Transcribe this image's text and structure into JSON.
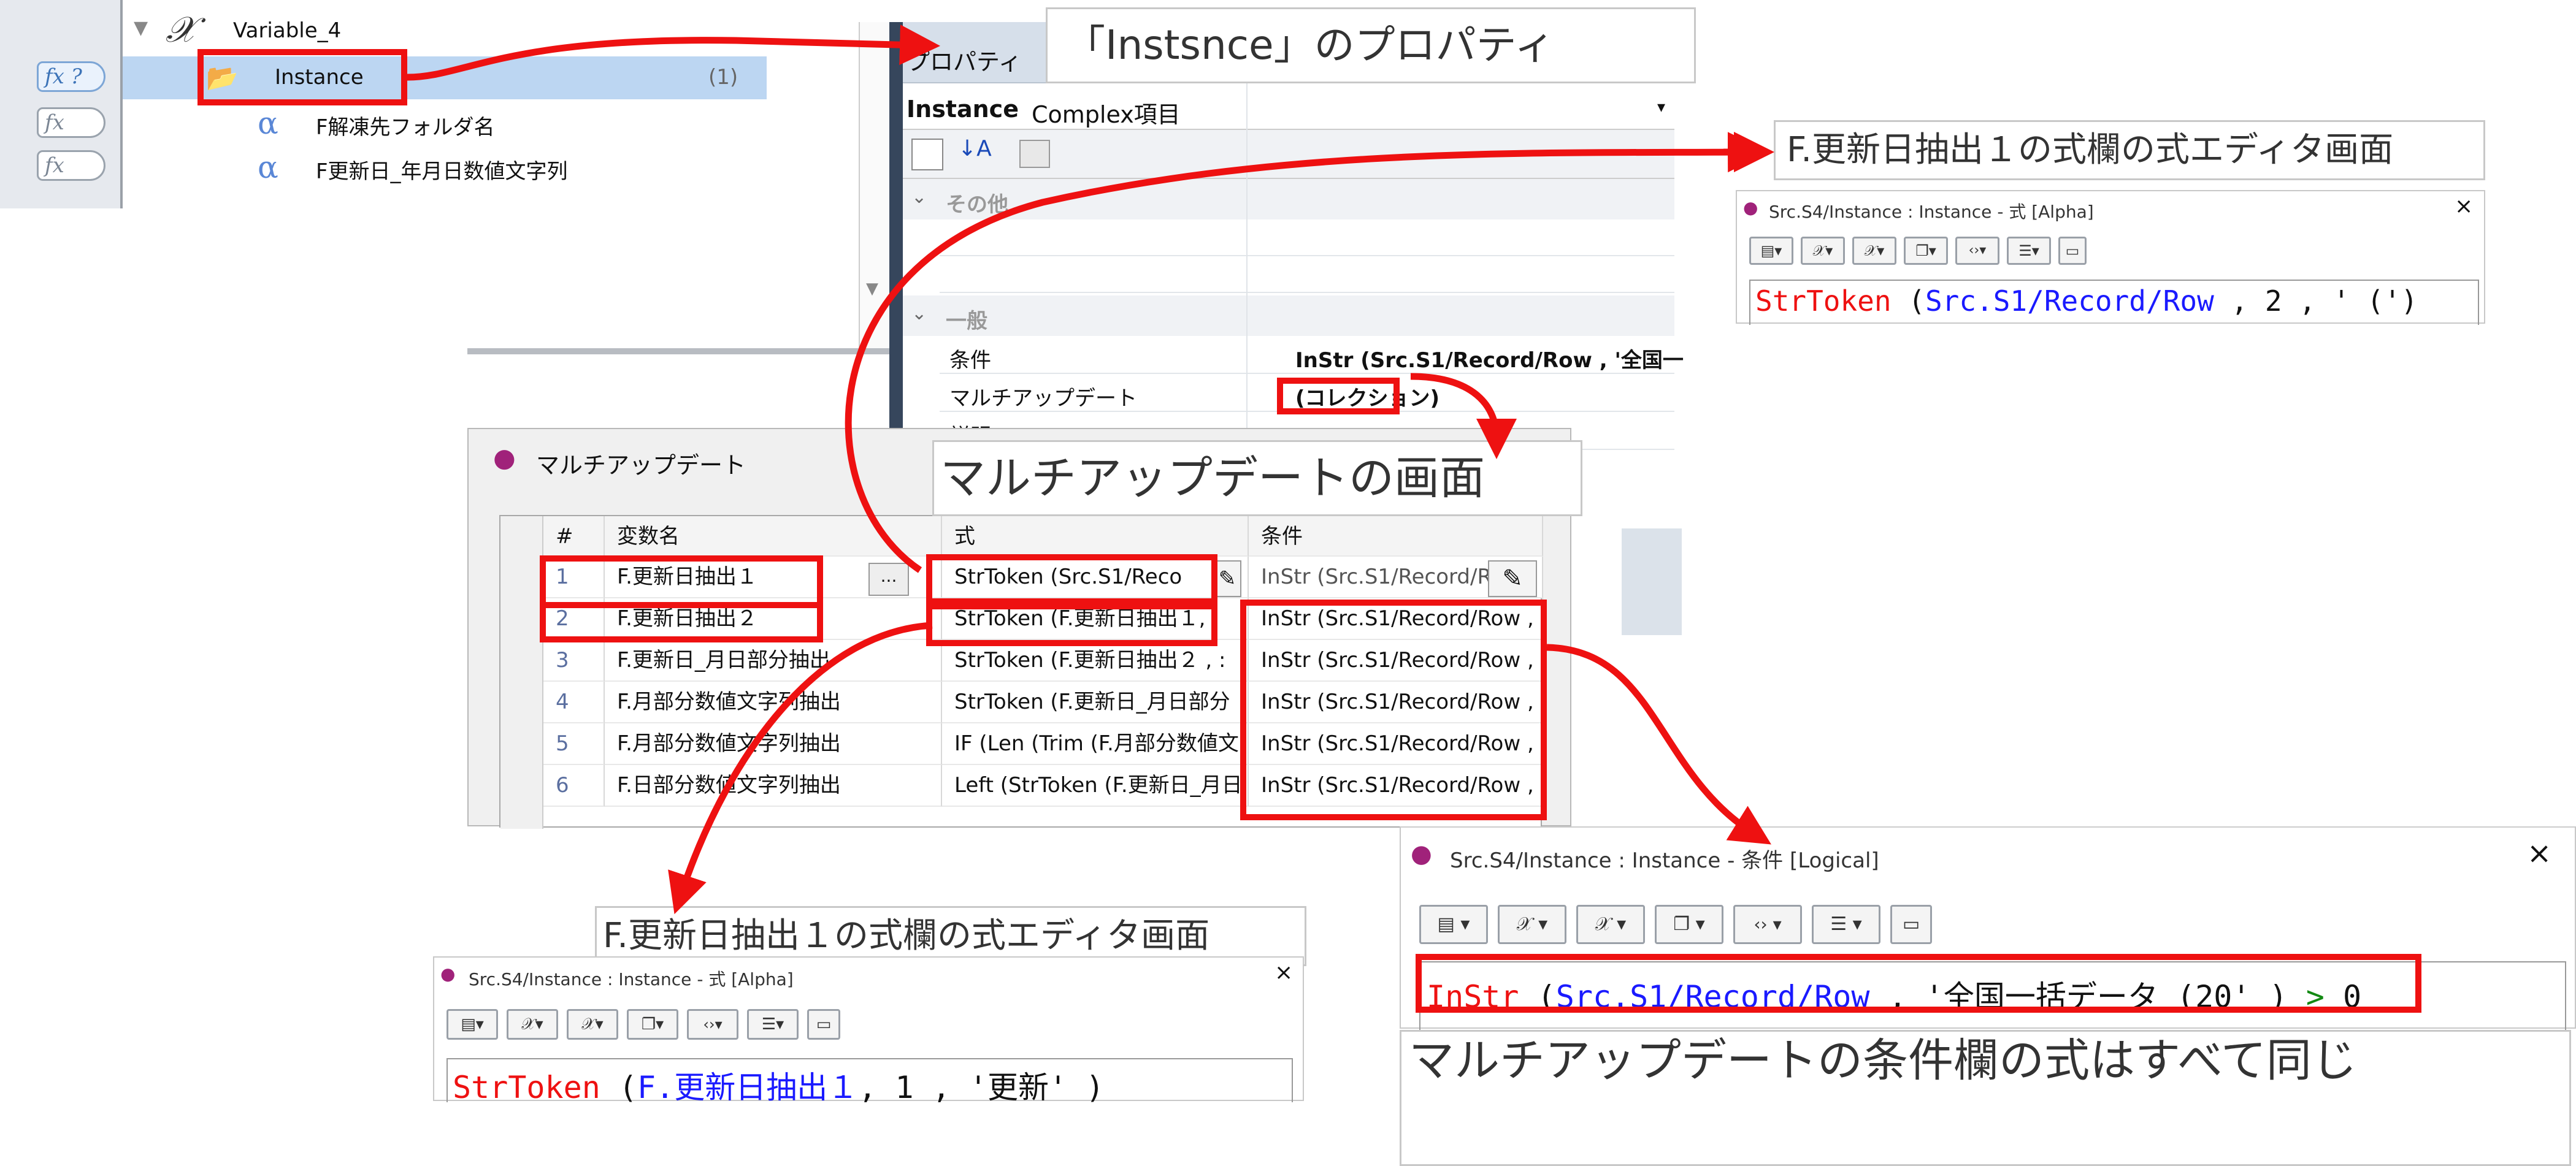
{
  "tree": {
    "variable_name": "Variable_4",
    "selected_item": "Instance",
    "selected_count": "(1)",
    "items": [
      "F解凍先フォルダ名",
      "F更新日_年月日数値文字列"
    ],
    "fx_labels": [
      "fx ?",
      "fx",
      "fx"
    ]
  },
  "properties": {
    "title": "プロパティ",
    "object_name": "Instance",
    "object_type": "Complex項目",
    "sections": {
      "other": "その他",
      "general": "一般"
    },
    "rows": [
      {
        "name": "条件",
        "value": "InStr (Src.S1/Record/Row , '全国一"
      },
      {
        "name": "マルチアップデート",
        "value": "(コレクション)"
      },
      {
        "name": "説明",
        "value": ""
      }
    ]
  },
  "callouts": {
    "instance_props": "「Instsnce」のプロパティ",
    "top_editor": "F.更新日抽出１の式欄の式エディタ画面",
    "multi_screen": "マルチアップデートの画面",
    "bottom_editor": "F.更新日抽出１の式欄の式エディタ画面",
    "same_condition": "マルチアップデートの条件欄の式はすべて同じ"
  },
  "multiupdate": {
    "title": "マルチアップデート",
    "columns": [
      "#",
      "変数名",
      "式",
      "条件"
    ],
    "rows": [
      {
        "n": "1",
        "var": "F.更新日抽出１",
        "expr": "StrToken (Src.S1/Reco",
        "cond": "InStr (Src.S1/Record/R"
      },
      {
        "n": "2",
        "var": "F.更新日抽出２",
        "expr": "StrToken (F.更新日抽出１, ",
        "cond": "InStr (Src.S1/Record/Row , '"
      },
      {
        "n": "3",
        "var": "F.更新日_月日部分抽出",
        "expr": "StrToken (F.更新日抽出２ , :",
        "cond": "InStr (Src.S1/Record/Row , '"
      },
      {
        "n": "4",
        "var": "F.月部分数値文字列抽出",
        "expr": "StrToken (F.更新日_月日部分",
        "cond": "InStr (Src.S1/Record/Row , '"
      },
      {
        "n": "5",
        "var": "F.月部分数値文字列抽出",
        "expr": "IF (Len (Trim (F.月部分数値文",
        "cond": "InStr (Src.S1/Record/Row , '"
      },
      {
        "n": "6",
        "var": "F.日部分数値文字列抽出",
        "expr": "Left (StrToken (F.更新日_月日",
        "cond": "InStr (Src.S1/Record/Row , '"
      }
    ],
    "ellipsis": "..."
  },
  "editor_top": {
    "title": "Src.S4/Instance : Instance - 式 [Alpha]",
    "code": {
      "func": "StrToken",
      "open": " (",
      "arg": "Src.S1/Record/Row",
      "rest": " , 2 , ' (')"
    }
  },
  "editor_bottom": {
    "title": "Src.S4/Instance : Instance - 式 [Alpha]",
    "code": {
      "func": "StrToken",
      "open": " (",
      "arg": "F.更新日抽出１",
      "rest": ", 1 , '更新' )"
    }
  },
  "editor_cond": {
    "title": "Src.S4/Instance : Instance - 条件 [Logical]",
    "code": {
      "func": "InStr",
      "open": " (",
      "arg": "Src.S1/Record/Row",
      "rest": " , '全国一括データ (20' )",
      "op": " > ",
      "num": "0"
    }
  },
  "toolbar_icons": [
    "insert-function-icon",
    "variable-icon",
    "variable-alt-icon",
    "copy-icon",
    "code-icon",
    "tree-icon",
    "folder-icon"
  ],
  "colors": {
    "arrow": "#ee1111",
    "code_func": "#ee1111",
    "code_arg": "#1a1aff",
    "selection": "#bcd6f2"
  }
}
